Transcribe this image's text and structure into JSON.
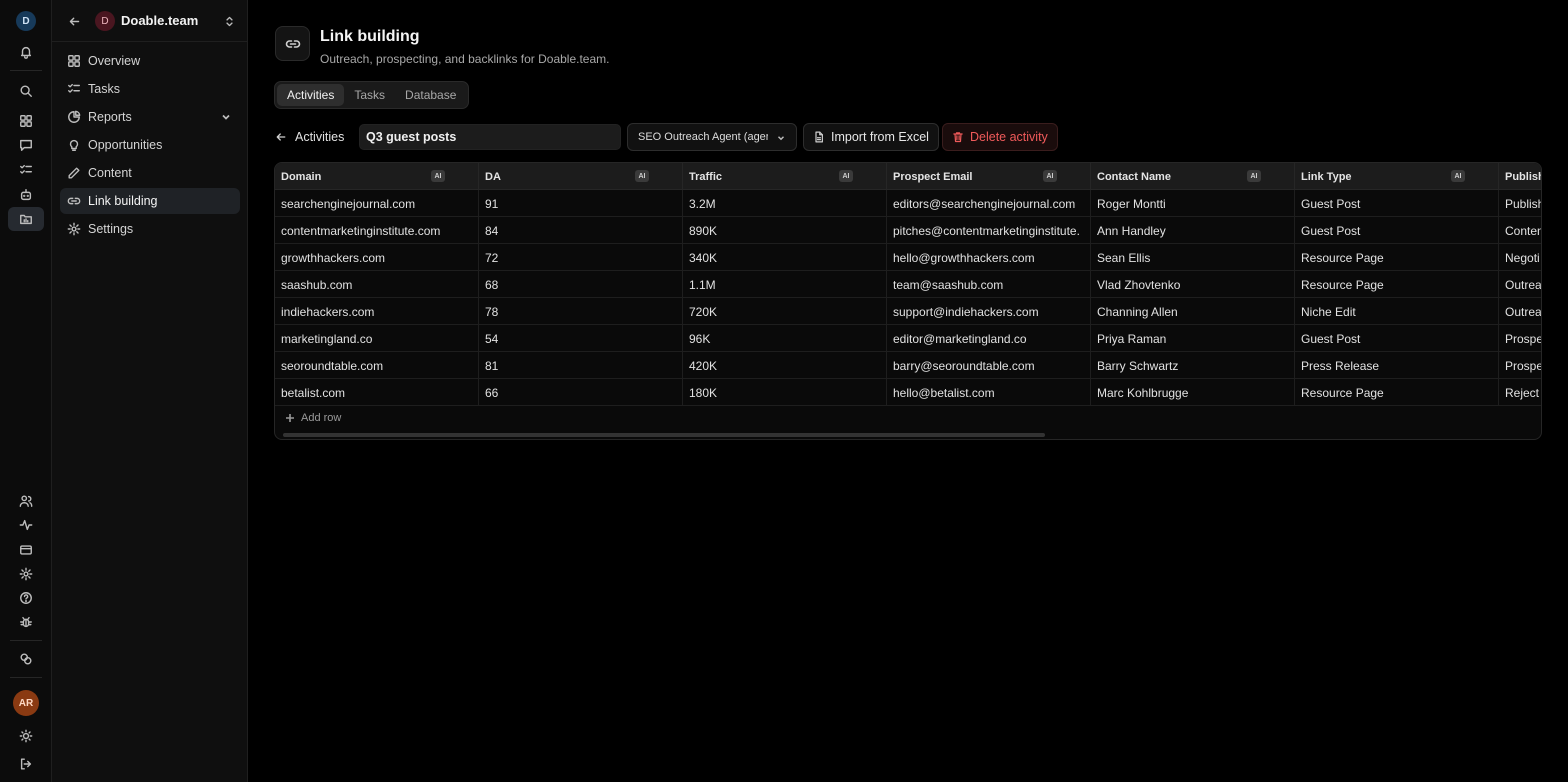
{
  "rail": {
    "workspace_initial": "D",
    "user_initials": "AR",
    "icons_top": [
      "bell-icon",
      "search-icon",
      "grid-icon",
      "message-icon",
      "checklist-icon",
      "bot-icon",
      "folder-chart-icon"
    ],
    "icons_bottom": [
      "users-icon",
      "activity-icon",
      "card-icon",
      "gear-icon",
      "help-icon",
      "bug-icon",
      "coins-icon"
    ],
    "active_icon": "folder-chart-icon"
  },
  "sidebar": {
    "workspace_initial": "D",
    "workspace_name": "Doable.team",
    "items": [
      {
        "label": "Overview",
        "icon": "grid-icon"
      },
      {
        "label": "Tasks",
        "icon": "checklist-icon"
      },
      {
        "label": "Reports",
        "icon": "pie-chart-icon"
      },
      {
        "label": "Opportunities",
        "icon": "lightbulb-icon"
      },
      {
        "label": "Content",
        "icon": "pen-icon"
      },
      {
        "label": "Link building",
        "icon": "link-icon"
      },
      {
        "label": "Settings",
        "icon": "gear-icon"
      }
    ],
    "active_item": "Link building"
  },
  "page": {
    "title": "Link building",
    "subtitle": "Outreach, prospecting, and backlinks for Doable.team.",
    "icon": "link-icon"
  },
  "tabs": [
    "Activities",
    "Tasks",
    "Database"
  ],
  "active_tab": "Activities",
  "toolbar": {
    "back_label": "Activities",
    "activity_name": "Q3 guest posts",
    "agent_select": "SEO Outreach Agent (agent)",
    "import_label": "Import from Excel",
    "delete_label": "Delete activity"
  },
  "table": {
    "ai_chip": "AI",
    "columns": [
      "Domain",
      "DA",
      "Traffic",
      "Prospect Email",
      "Contact Name",
      "Link Type",
      "Publish"
    ],
    "rows": [
      [
        "searchenginejournal.com",
        "91",
        "3.2M",
        "editors@searchenginejournal.com",
        "Roger Montti",
        "Guest Post",
        "Publish"
      ],
      [
        "contentmarketinginstitute.com",
        "84",
        "890K",
        "pitches@contentmarketinginstitute.",
        "Ann Handley",
        "Guest Post",
        "Conten"
      ],
      [
        "growthhackers.com",
        "72",
        "340K",
        "hello@growthhackers.com",
        "Sean Ellis",
        "Resource Page",
        "Negoti"
      ],
      [
        "saashub.com",
        "68",
        "1.1M",
        "team@saashub.com",
        "Vlad Zhovtenko",
        "Resource Page",
        "Outrea"
      ],
      [
        "indiehackers.com",
        "78",
        "720K",
        "support@indiehackers.com",
        "Channing Allen",
        "Niche Edit",
        "Outrea"
      ],
      [
        "marketingland.co",
        "54",
        "96K",
        "editor@marketingland.co",
        "Priya Raman",
        "Guest Post",
        "Prospe"
      ],
      [
        "seoroundtable.com",
        "81",
        "420K",
        "barry@seoroundtable.com",
        "Barry Schwartz",
        "Press Release",
        "Prospe"
      ],
      [
        "betalist.com",
        "66",
        "180K",
        "hello@betalist.com",
        "Marc Kohlbrugge",
        "Resource Page",
        "Reject"
      ]
    ],
    "add_row_label": "Add row"
  }
}
